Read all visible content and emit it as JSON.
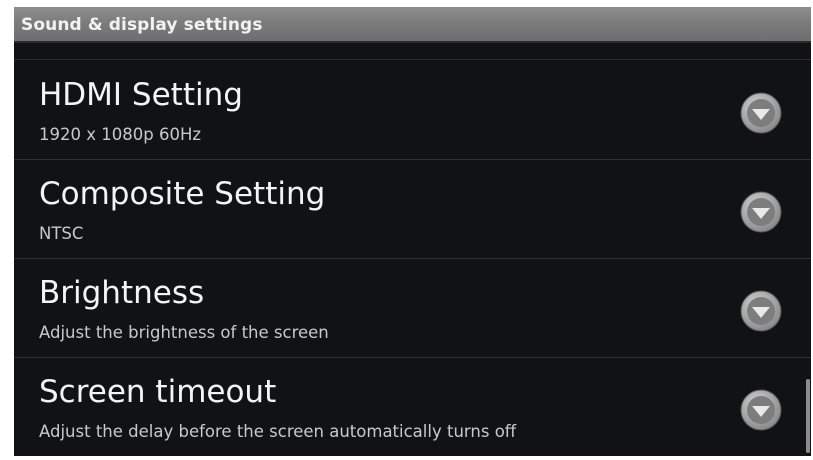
{
  "title_bar": {
    "title": "Sound & display settings"
  },
  "settings": [
    {
      "title": "HDMI Setting",
      "summary": "1920 x 1080p 60Hz",
      "icon": "dropdown-arrow-icon"
    },
    {
      "title": "Composite Setting",
      "summary": "NTSC",
      "icon": "dropdown-arrow-icon"
    },
    {
      "title": "Brightness",
      "summary": "Adjust the brightness of the screen",
      "icon": "dropdown-arrow-icon"
    },
    {
      "title": "Screen timeout",
      "summary": "Adjust the delay before the screen automatically turns off",
      "icon": "dropdown-arrow-icon"
    }
  ],
  "colors": {
    "background": "#111213",
    "title_bar": "#7c7c7c",
    "primary_text": "#f4f4f4",
    "secondary_text": "#c9c9c9"
  }
}
